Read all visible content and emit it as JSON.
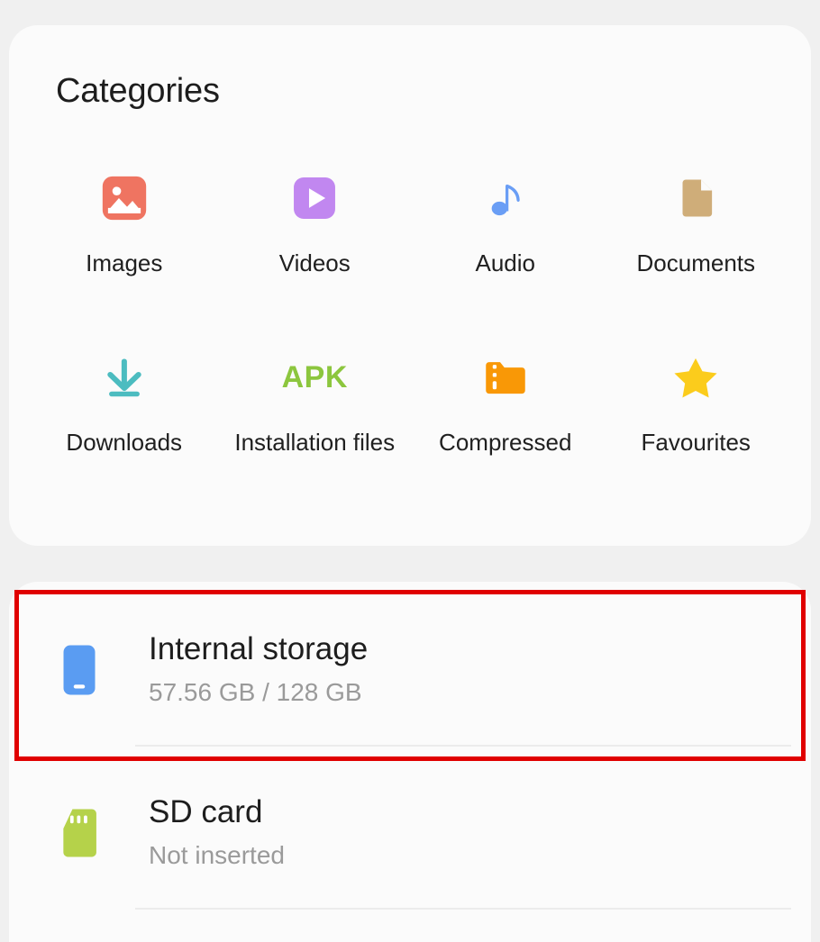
{
  "categories_card": {
    "title": "Categories",
    "items": [
      {
        "label": "Images",
        "icon": "image-icon",
        "color": "#ef7461"
      },
      {
        "label": "Videos",
        "icon": "video-play-icon",
        "color": "#c187f0"
      },
      {
        "label": "Audio",
        "icon": "music-note-icon",
        "color": "#6a9ef5"
      },
      {
        "label": "Documents",
        "icon": "document-icon",
        "color": "#cfad79"
      },
      {
        "label": "Downloads",
        "icon": "download-arrow-icon",
        "color": "#4cbcc0"
      },
      {
        "label": "Installation files",
        "icon": "apk-icon",
        "color": "#8cc63e",
        "icon_text": "APK"
      },
      {
        "label": "Compressed",
        "icon": "zip-folder-icon",
        "color": "#f99806"
      },
      {
        "label": "Favourites",
        "icon": "star-icon",
        "color": "#fbcc1c"
      }
    ]
  },
  "storage_card": {
    "rows": [
      {
        "title": "Internal storage",
        "subtitle": "57.56 GB / 128 GB",
        "icon": "phone-icon",
        "color": "#5a9cf2",
        "highlighted": true
      },
      {
        "title": "SD card",
        "subtitle": "Not inserted",
        "icon": "sd-card-icon",
        "color": "#b5d24a",
        "highlighted": false
      }
    ]
  },
  "annotation": {
    "highlight_color": "#e00000",
    "target": "Internal storage"
  }
}
